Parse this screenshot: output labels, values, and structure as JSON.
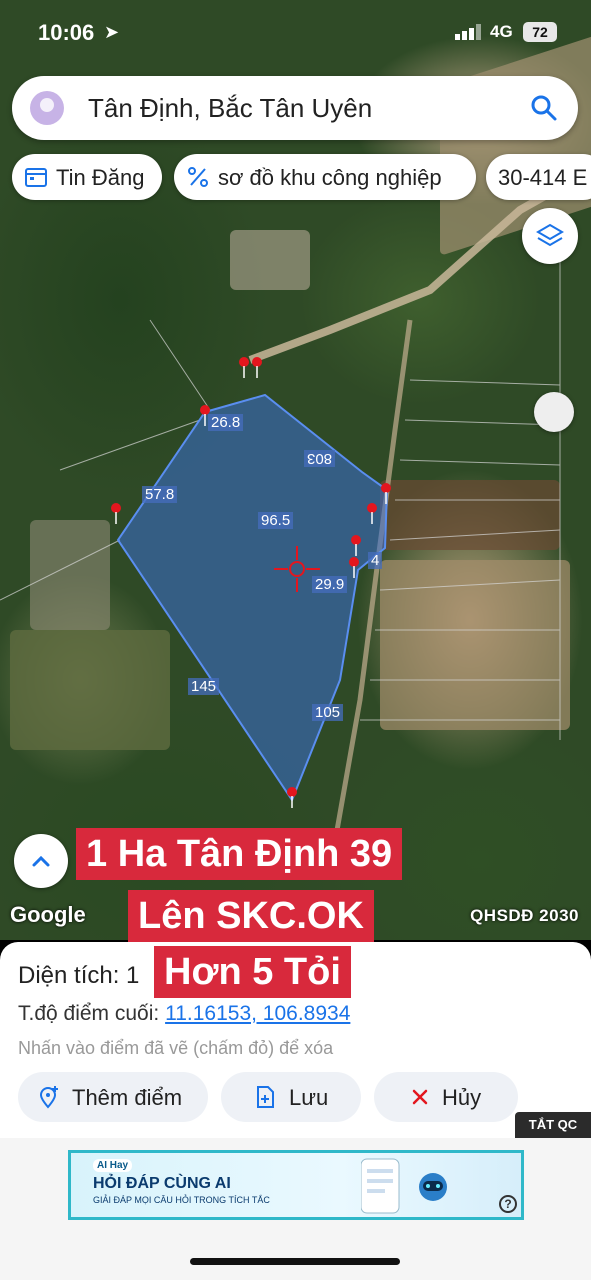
{
  "status": {
    "time": "10:06",
    "location_arrow": "location-arrow-icon",
    "network": "4G",
    "battery": "72"
  },
  "search": {
    "text": "Tân Định, Bắc Tân Uyên",
    "icon": "search-icon"
  },
  "chips": [
    {
      "label": "Tin Đăng",
      "icon": "calendar-icon"
    },
    {
      "label": "sơ đồ khu công nghiệp",
      "icon": "percent-icon"
    },
    {
      "label": "30-414 E",
      "icon": ""
    }
  ],
  "map": {
    "segment_labels": [
      "26.8",
      "803",
      "57.8",
      "96.5",
      "4",
      "29.9",
      "145",
      "105"
    ],
    "google": "Google",
    "plan_label": "QHSDĐ 2030"
  },
  "overlay": {
    "line1": "1 Ha Tân Định 39",
    "line2": "Lên SKC.OK",
    "line3": "Hơn 5 Tỏi"
  },
  "sheet": {
    "area_label": "Diện tích: 1",
    "coord_label": "T.độ điểm cuối:",
    "coord_value": "11.16153, 106.8934",
    "hint": "Nhấn vào điểm đã vẽ (chấm đỏ) để xóa",
    "buttons": [
      {
        "label": "Thêm điểm",
        "icon": "add-point-icon"
      },
      {
        "label": "Lưu",
        "icon": "save-icon"
      },
      {
        "label": "Hủy",
        "icon": "close-icon"
      }
    ]
  },
  "ad": {
    "close": "TẮT QC",
    "brand": "AI Hay",
    "title": "HỎI ĐÁP CÙNG AI",
    "subtitle": "GIẢI ĐÁP MỌI CÂU HỎI TRONG TÍCH TẮC",
    "help": "?"
  },
  "colors": {
    "polygon_fill": "#3b6fd1",
    "pin": "#e3161e",
    "overlay": "#d8293c",
    "link": "#1a73e8"
  }
}
